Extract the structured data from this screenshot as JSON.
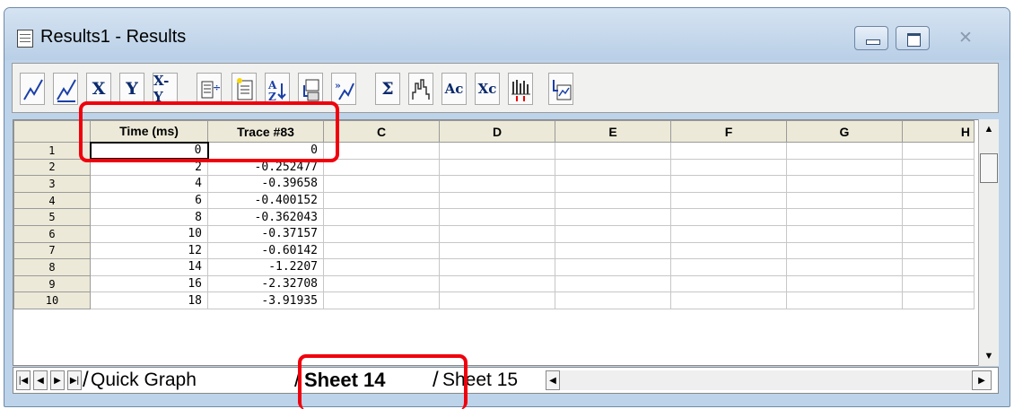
{
  "window": {
    "title": "Results1 - Results",
    "close_glyph": "✕"
  },
  "toolbar": {
    "buttons": [
      {
        "icon": "line-graph-icon"
      },
      {
        "icon": "line-graph-marker-icon"
      },
      {
        "icon": "x-column-icon",
        "text": "X"
      },
      {
        "icon": "y-column-icon",
        "text": "Y"
      },
      {
        "icon": "xy-column-icon",
        "text": "X-Y"
      },
      {
        "icon": "insert-column-icon"
      },
      {
        "icon": "paste-icon"
      },
      {
        "icon": "sort-icon"
      },
      {
        "icon": "transform-icon"
      },
      {
        "icon": "arrow-graph-icon"
      },
      {
        "icon": "sum-icon",
        "text": "Σ"
      },
      {
        "icon": "histogram-icon"
      },
      {
        "icon": "ac-icon",
        "text": "Ac"
      },
      {
        "icon": "xc-icon",
        "text": "Xc"
      },
      {
        "icon": "bar-arrows-icon"
      },
      {
        "icon": "export-graph-icon"
      }
    ]
  },
  "grid": {
    "columns": [
      "Time (ms)",
      "Trace #83",
      "C",
      "D",
      "E",
      "F",
      "G",
      "H"
    ],
    "rows": [
      {
        "n": "1",
        "time": "0",
        "trace": "0"
      },
      {
        "n": "2",
        "time": "2",
        "trace": "-0.252477"
      },
      {
        "n": "3",
        "time": "4",
        "trace": "-0.39658"
      },
      {
        "n": "4",
        "time": "6",
        "trace": "-0.400152"
      },
      {
        "n": "5",
        "time": "8",
        "trace": "-0.362043"
      },
      {
        "n": "6",
        "time": "10",
        "trace": "-0.37157"
      },
      {
        "n": "7",
        "time": "12",
        "trace": "-0.60142"
      },
      {
        "n": "8",
        "time": "14",
        "trace": "-1.2207"
      },
      {
        "n": "9",
        "time": "16",
        "trace": "-2.32708"
      },
      {
        "n": "10",
        "time": "18",
        "trace": "-3.91935"
      }
    ]
  },
  "tabs": {
    "quick_graph": "Quick Graph",
    "sheet14": "Sheet 14",
    "sheet15": "Sheet 15"
  },
  "annotation_color": "#f0000c"
}
